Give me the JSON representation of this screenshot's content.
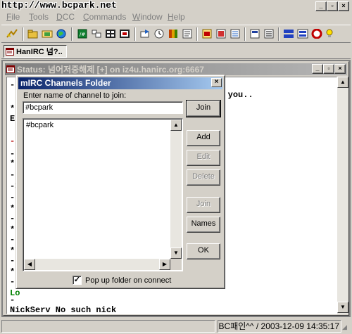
{
  "watermark": "http://www.bcpark.net",
  "menubar": {
    "items": [
      {
        "label": "File"
      },
      {
        "label": "Tools"
      },
      {
        "label": "DCC"
      },
      {
        "label": "Commands"
      },
      {
        "label": "Window"
      },
      {
        "label": "Help"
      }
    ]
  },
  "window_buttons": {
    "minimize": "_",
    "restore": "▫",
    "close": "×"
  },
  "switchbar": {
    "tab_label": "HanIRC 넘?.."
  },
  "status_window": {
    "title": "Status: 넘어저중해제 [+] on iz4u.hanirc.org:6667",
    "lines": [
      {
        "text": "-",
        "color": "#000000"
      },
      {
        "text": "                                        or you..",
        "color": "#000000"
      },
      {
        "text": "**",
        "color": "#000000"
      },
      {
        "text": "En",
        "color": "#000000"
      },
      {
        "text": "-i",
        "color": "#b00000"
      },
      {
        "text": "-",
        "color": "#000000"
      },
      {
        "text": "*",
        "color": "#000000"
      },
      {
        "text": "-",
        "color": "#000000"
      },
      {
        "text": "->",
        "color": "#000000"
      },
      {
        "text": "-",
        "color": "#000000"
      },
      {
        "text": "*",
        "color": "#000000"
      },
      {
        "text": "-",
        "color": "#000000"
      },
      {
        "text": "*",
        "color": "#000000"
      },
      {
        "text": "-",
        "color": "#000000"
      },
      {
        "text": "*",
        "color": "#000000"
      },
      {
        "text": "-",
        "color": "#000000"
      },
      {
        "text": "*",
        "color": "#000000"
      },
      {
        "text": "-",
        "color": "#000000"
      },
      {
        "text": "Lo",
        "color": "#008000"
      },
      {
        "text": "-",
        "color": "#000000"
      },
      {
        "text": "NickServ No such nick",
        "color": "#000000"
      },
      {
        "text": "-",
        "color": "#000000"
      }
    ]
  },
  "dialog": {
    "title": "mIRC Channels Folder",
    "close": "×",
    "prompt": "Enter name of channel to join:",
    "input_value": "#bcpark",
    "list_items": [
      "#bcpark"
    ],
    "buttons": {
      "join_top": "Join",
      "add": "Add",
      "edit": "Edit",
      "delete": "Delete",
      "join": "Join",
      "names": "Names",
      "ok": "OK"
    },
    "checkbox_label": "Pop up folder on connect",
    "checkbox_checked": true,
    "check_mark": "✓"
  },
  "statusbar": {
    "clock": "BC패인^^ / 2003-12-09 14:35:17"
  },
  "toolbar": {
    "icons": [
      "connect-icon",
      "folder-icon",
      "options-icon",
      "globe-icon",
      "address-book-icon",
      "channels-icon",
      "list-icon",
      "scripts-icon",
      "dcc-send-icon",
      "dcc-chat-icon",
      "timer-icon",
      "colors-icon",
      "notify-icon",
      "log-icon",
      "tile-horizontal-icon",
      "tile-vertical-icon",
      "cascade-icon",
      "arrange-icon",
      "help-icon",
      "about-icon"
    ]
  }
}
